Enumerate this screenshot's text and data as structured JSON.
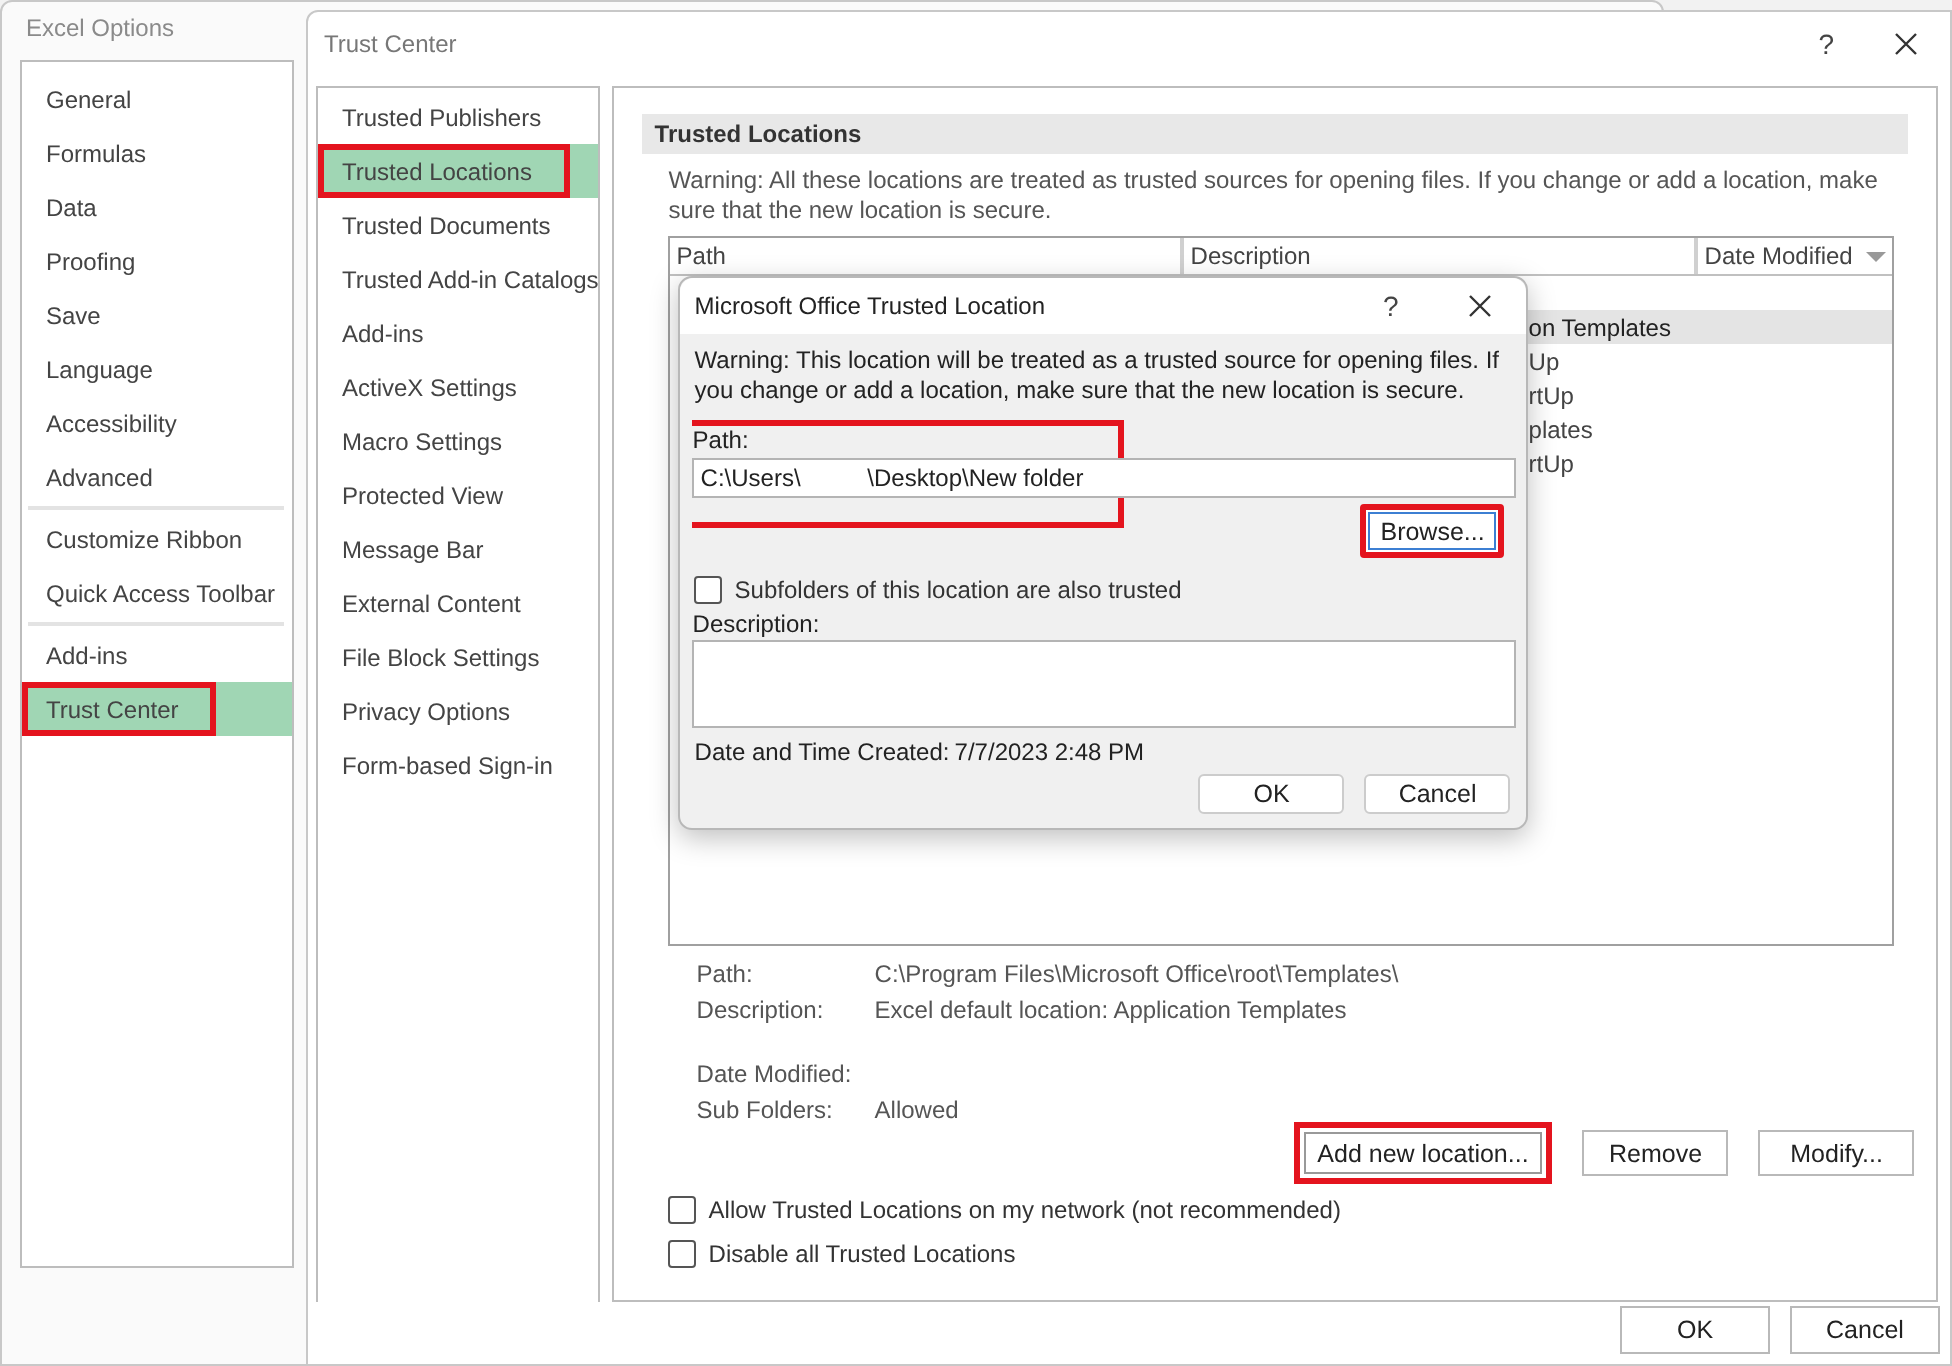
{
  "excel_options": {
    "title": "Excel Options",
    "sidebar": {
      "groups": [
        [
          {
            "label": "General",
            "selected": false,
            "highlighted": false
          },
          {
            "label": "Formulas",
            "selected": false,
            "highlighted": false
          },
          {
            "label": "Data",
            "selected": false,
            "highlighted": false
          },
          {
            "label": "Proofing",
            "selected": false,
            "highlighted": false
          },
          {
            "label": "Save",
            "selected": false,
            "highlighted": false
          },
          {
            "label": "Language",
            "selected": false,
            "highlighted": false
          },
          {
            "label": "Accessibility",
            "selected": false,
            "highlighted": false
          },
          {
            "label": "Advanced",
            "selected": false,
            "highlighted": false
          }
        ],
        [
          {
            "label": "Customize Ribbon",
            "selected": false,
            "highlighted": false
          },
          {
            "label": "Quick Access Toolbar",
            "selected": false,
            "highlighted": false
          }
        ],
        [
          {
            "label": "Add-ins",
            "selected": false,
            "highlighted": false
          },
          {
            "label": "Trust Center",
            "selected": true,
            "highlighted": true
          }
        ]
      ]
    }
  },
  "trust_center": {
    "title": "Trust Center",
    "help": "?",
    "nav": [
      {
        "label": "Trusted Publishers",
        "selected": false,
        "highlighted": false
      },
      {
        "label": "Trusted Locations",
        "selected": true,
        "highlighted": true
      },
      {
        "label": "Trusted Documents",
        "selected": false,
        "highlighted": false
      },
      {
        "label": "Trusted Add-in Catalogs",
        "selected": false,
        "highlighted": false
      },
      {
        "label": "Add-ins",
        "selected": false,
        "highlighted": false
      },
      {
        "label": "ActiveX Settings",
        "selected": false,
        "highlighted": false
      },
      {
        "label": "Macro Settings",
        "selected": false,
        "highlighted": false
      },
      {
        "label": "Protected View",
        "selected": false,
        "highlighted": false
      },
      {
        "label": "Message Bar",
        "selected": false,
        "highlighted": false
      },
      {
        "label": "External Content",
        "selected": false,
        "highlighted": false
      },
      {
        "label": "File Block Settings",
        "selected": false,
        "highlighted": false
      },
      {
        "label": "Privacy Options",
        "selected": false,
        "highlighted": false
      },
      {
        "label": "Form-based Sign-in",
        "selected": false,
        "highlighted": false
      }
    ],
    "section": {
      "heading": "Trusted Locations",
      "warning": "Warning: All these locations are treated as trusted sources for opening files.  If you change or add a location, make sure that the new location is secure.",
      "table": {
        "columns": [
          {
            "label": "Path",
            "kind": "plain"
          },
          {
            "label": "Description",
            "kind": "plain"
          },
          {
            "label": "Date Modified",
            "kind": "dropdown"
          }
        ],
        "rows": [
          {
            "description": "on Templates",
            "selected": true
          },
          {
            "description": "Up",
            "selected": false
          },
          {
            "description": "rtUp",
            "selected": false
          },
          {
            "description": "plates",
            "selected": false
          },
          {
            "description": "rtUp",
            "selected": false
          }
        ]
      },
      "details": [
        {
          "label": "Path:",
          "value": "C:\\Program Files\\Microsoft Office\\root\\Templates\\"
        },
        {
          "label": "Description:",
          "value": "Excel default location: Application Templates"
        },
        {
          "label": "Date Modified:"
        },
        {
          "label": "Sub Folders:",
          "value": "Allowed"
        }
      ],
      "buttons": [
        {
          "label": "Add new location...",
          "highlighted": true
        },
        {
          "label": "Remove",
          "highlighted": false
        },
        {
          "label": "Modify...",
          "highlighted": false
        }
      ],
      "checkboxes": [
        {
          "label": "Allow Trusted Locations on my network (not recommended)",
          "checked": false
        },
        {
          "label": "Disable all Trusted Locations",
          "checked": false
        }
      ]
    },
    "footer_buttons": [
      "OK",
      "Cancel"
    ]
  },
  "dialog": {
    "title": "Microsoft Office Trusted Location",
    "help": "?",
    "warning": "Warning: This location will be treated as a trusted source for opening files. If you change or add a location, make sure that the new location is secure.",
    "path": {
      "label": "Path:",
      "value": "C:\\Users\\          \\Desktop\\New folder",
      "highlighted": true
    },
    "browse": {
      "label": "Browse...",
      "highlighted": true
    },
    "subfolders": {
      "label": "Subfolders of this location are also trusted",
      "checked": false
    },
    "description_label": "Description:",
    "created": {
      "label": "Date and Time Created:",
      "value": "7/7/2023 2:48 PM"
    },
    "buttons": [
      "OK",
      "Cancel"
    ]
  }
}
